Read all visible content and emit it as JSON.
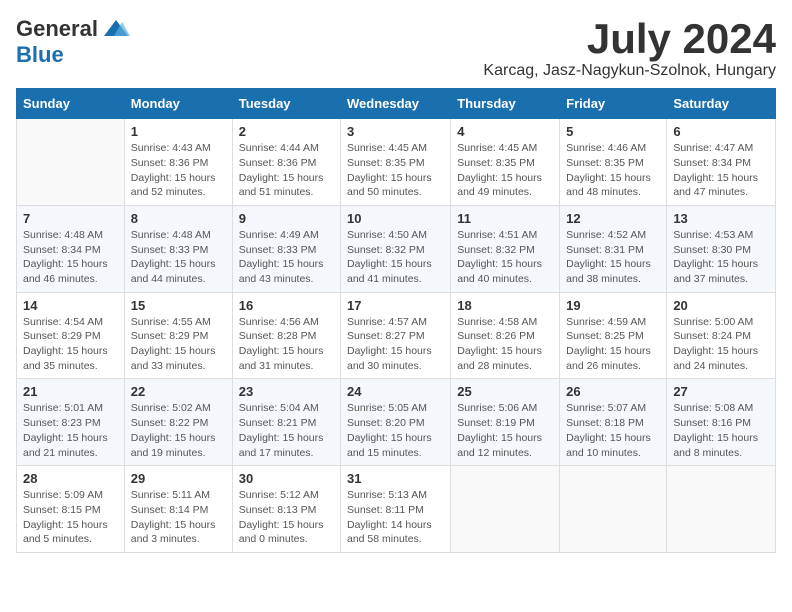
{
  "header": {
    "logo_general": "General",
    "logo_blue": "Blue",
    "month_year": "July 2024",
    "location": "Karcag, Jasz-Nagykun-Szolnok, Hungary"
  },
  "calendar": {
    "days_of_week": [
      "Sunday",
      "Monday",
      "Tuesday",
      "Wednesday",
      "Thursday",
      "Friday",
      "Saturday"
    ],
    "weeks": [
      [
        {
          "day": "",
          "info": ""
        },
        {
          "day": "1",
          "info": "Sunrise: 4:43 AM\nSunset: 8:36 PM\nDaylight: 15 hours\nand 52 minutes."
        },
        {
          "day": "2",
          "info": "Sunrise: 4:44 AM\nSunset: 8:36 PM\nDaylight: 15 hours\nand 51 minutes."
        },
        {
          "day": "3",
          "info": "Sunrise: 4:45 AM\nSunset: 8:35 PM\nDaylight: 15 hours\nand 50 minutes."
        },
        {
          "day": "4",
          "info": "Sunrise: 4:45 AM\nSunset: 8:35 PM\nDaylight: 15 hours\nand 49 minutes."
        },
        {
          "day": "5",
          "info": "Sunrise: 4:46 AM\nSunset: 8:35 PM\nDaylight: 15 hours\nand 48 minutes."
        },
        {
          "day": "6",
          "info": "Sunrise: 4:47 AM\nSunset: 8:34 PM\nDaylight: 15 hours\nand 47 minutes."
        }
      ],
      [
        {
          "day": "7",
          "info": "Sunrise: 4:48 AM\nSunset: 8:34 PM\nDaylight: 15 hours\nand 46 minutes."
        },
        {
          "day": "8",
          "info": "Sunrise: 4:48 AM\nSunset: 8:33 PM\nDaylight: 15 hours\nand 44 minutes."
        },
        {
          "day": "9",
          "info": "Sunrise: 4:49 AM\nSunset: 8:33 PM\nDaylight: 15 hours\nand 43 minutes."
        },
        {
          "day": "10",
          "info": "Sunrise: 4:50 AM\nSunset: 8:32 PM\nDaylight: 15 hours\nand 41 minutes."
        },
        {
          "day": "11",
          "info": "Sunrise: 4:51 AM\nSunset: 8:32 PM\nDaylight: 15 hours\nand 40 minutes."
        },
        {
          "day": "12",
          "info": "Sunrise: 4:52 AM\nSunset: 8:31 PM\nDaylight: 15 hours\nand 38 minutes."
        },
        {
          "day": "13",
          "info": "Sunrise: 4:53 AM\nSunset: 8:30 PM\nDaylight: 15 hours\nand 37 minutes."
        }
      ],
      [
        {
          "day": "14",
          "info": "Sunrise: 4:54 AM\nSunset: 8:29 PM\nDaylight: 15 hours\nand 35 minutes."
        },
        {
          "day": "15",
          "info": "Sunrise: 4:55 AM\nSunset: 8:29 PM\nDaylight: 15 hours\nand 33 minutes."
        },
        {
          "day": "16",
          "info": "Sunrise: 4:56 AM\nSunset: 8:28 PM\nDaylight: 15 hours\nand 31 minutes."
        },
        {
          "day": "17",
          "info": "Sunrise: 4:57 AM\nSunset: 8:27 PM\nDaylight: 15 hours\nand 30 minutes."
        },
        {
          "day": "18",
          "info": "Sunrise: 4:58 AM\nSunset: 8:26 PM\nDaylight: 15 hours\nand 28 minutes."
        },
        {
          "day": "19",
          "info": "Sunrise: 4:59 AM\nSunset: 8:25 PM\nDaylight: 15 hours\nand 26 minutes."
        },
        {
          "day": "20",
          "info": "Sunrise: 5:00 AM\nSunset: 8:24 PM\nDaylight: 15 hours\nand 24 minutes."
        }
      ],
      [
        {
          "day": "21",
          "info": "Sunrise: 5:01 AM\nSunset: 8:23 PM\nDaylight: 15 hours\nand 21 minutes."
        },
        {
          "day": "22",
          "info": "Sunrise: 5:02 AM\nSunset: 8:22 PM\nDaylight: 15 hours\nand 19 minutes."
        },
        {
          "day": "23",
          "info": "Sunrise: 5:04 AM\nSunset: 8:21 PM\nDaylight: 15 hours\nand 17 minutes."
        },
        {
          "day": "24",
          "info": "Sunrise: 5:05 AM\nSunset: 8:20 PM\nDaylight: 15 hours\nand 15 minutes."
        },
        {
          "day": "25",
          "info": "Sunrise: 5:06 AM\nSunset: 8:19 PM\nDaylight: 15 hours\nand 12 minutes."
        },
        {
          "day": "26",
          "info": "Sunrise: 5:07 AM\nSunset: 8:18 PM\nDaylight: 15 hours\nand 10 minutes."
        },
        {
          "day": "27",
          "info": "Sunrise: 5:08 AM\nSunset: 8:16 PM\nDaylight: 15 hours\nand 8 minutes."
        }
      ],
      [
        {
          "day": "28",
          "info": "Sunrise: 5:09 AM\nSunset: 8:15 PM\nDaylight: 15 hours\nand 5 minutes."
        },
        {
          "day": "29",
          "info": "Sunrise: 5:11 AM\nSunset: 8:14 PM\nDaylight: 15 hours\nand 3 minutes."
        },
        {
          "day": "30",
          "info": "Sunrise: 5:12 AM\nSunset: 8:13 PM\nDaylight: 15 hours\nand 0 minutes."
        },
        {
          "day": "31",
          "info": "Sunrise: 5:13 AM\nSunset: 8:11 PM\nDaylight: 14 hours\nand 58 minutes."
        },
        {
          "day": "",
          "info": ""
        },
        {
          "day": "",
          "info": ""
        },
        {
          "day": "",
          "info": ""
        }
      ]
    ]
  }
}
